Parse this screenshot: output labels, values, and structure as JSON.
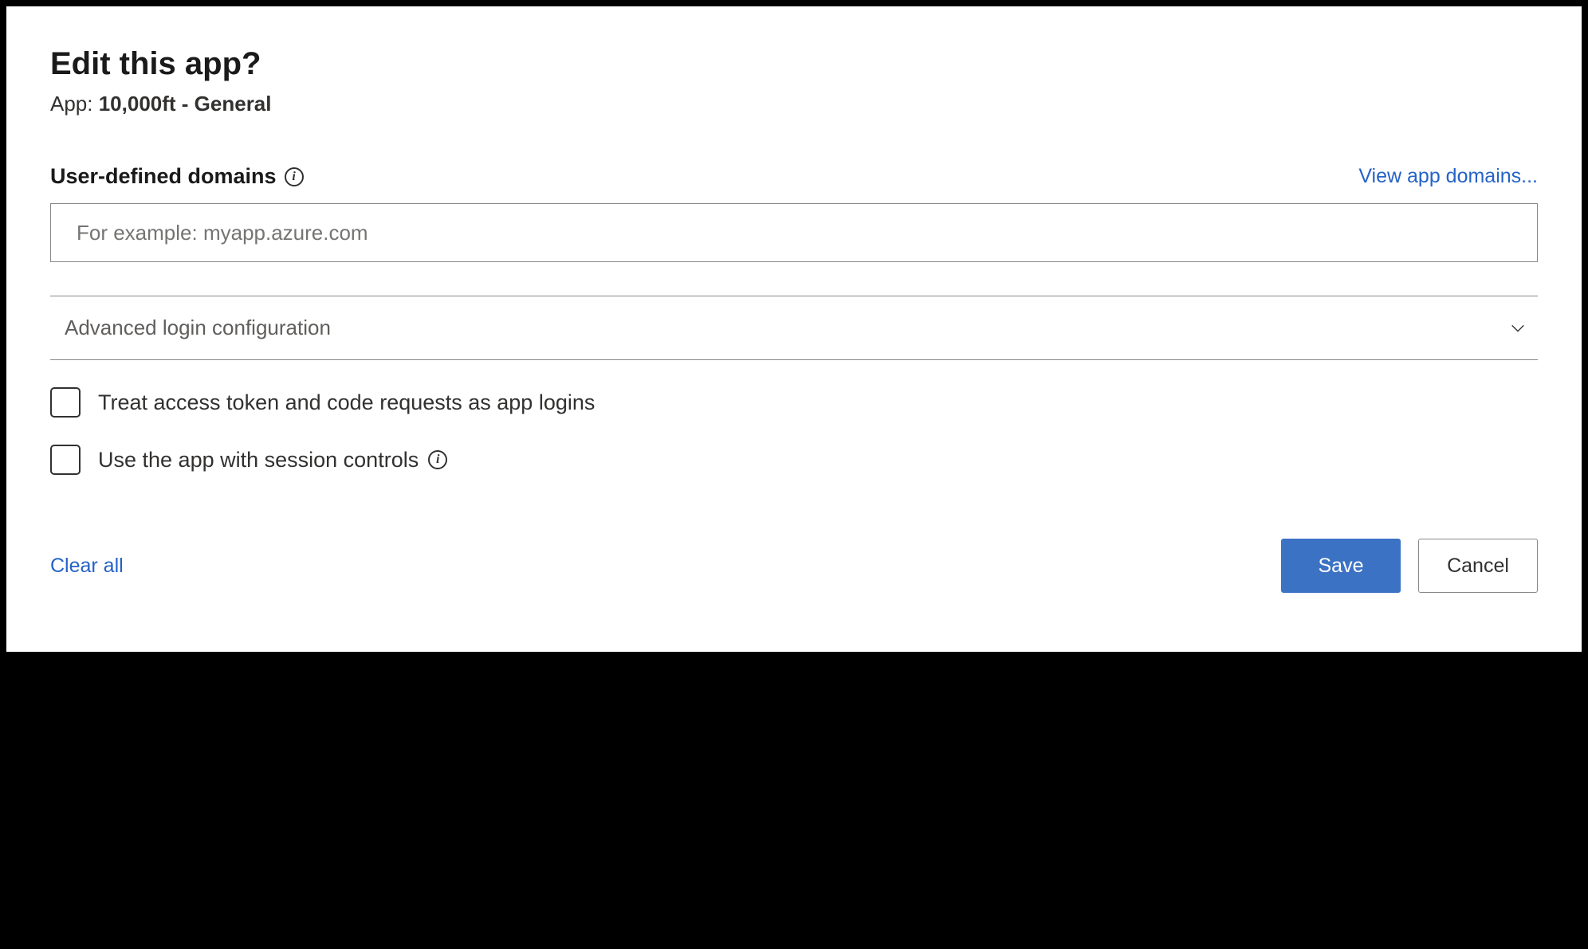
{
  "header": {
    "title": "Edit this app?",
    "app_prefix": "App: ",
    "app_name": "10,000ft - General"
  },
  "domains": {
    "label": "User-defined domains",
    "info_tooltip": "info",
    "view_link": "View app domains...",
    "input_placeholder": "For example: myapp.azure.com",
    "input_value": ""
  },
  "expander": {
    "label": "Advanced login configuration"
  },
  "checkboxes": {
    "treat_access": {
      "label": "Treat access token and code requests as app logins",
      "checked": false
    },
    "session_controls": {
      "label": "Use the app with session controls",
      "checked": false
    }
  },
  "footer": {
    "clear_all": "Clear all",
    "save": "Save",
    "cancel": "Cancel"
  }
}
